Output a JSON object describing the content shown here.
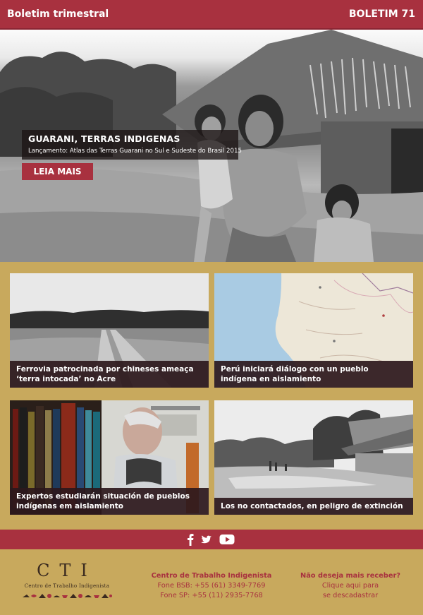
{
  "header": {
    "left_title": "Boletim trimestral",
    "right_title": "BOLETIM 71"
  },
  "hero": {
    "title": "GUARANI, TERRAS INDIGENAS",
    "subtitle": "Lançamento: Atlas das Terras Guarani no Sul e Sudeste do Brasil 2015",
    "button_label": "LEIA MAIS"
  },
  "cards": [
    {
      "caption": "Ferrovia patrocinada por chineses ameaça ‘terra intocada’ no Acre"
    },
    {
      "caption": "Perú iniciará diálogo con un pueblo indígena en aislamiento"
    },
    {
      "caption": "Expertos estudiarán situación de pueblos indígenas em aislamiento"
    },
    {
      "caption": "Los no contactados, en peligro de extinción"
    }
  ],
  "social": {
    "icons": [
      "facebook-icon",
      "twitter-icon",
      "youtube-icon"
    ]
  },
  "footer": {
    "logo_letters": "CTI",
    "logo_name": "Centro de Trabalho Indigenista",
    "org_name": "Centro de Trabalho Indigenista",
    "phone_bsb": "Fone BSB: +55 (61) 3349-7769",
    "phone_sp": "Fone SP: +55 (11) 2935-7768",
    "unsub_question": "Não deseja mais receber?",
    "unsub_line1": "Clique aqui para",
    "unsub_line2": "se descadastrar"
  },
  "colors": {
    "brand_red": "#a8313f",
    "tan": "#c8a95d",
    "caption_dark": "#2d181c"
  }
}
